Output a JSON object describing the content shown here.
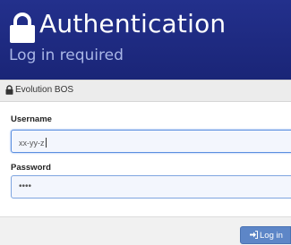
{
  "header": {
    "title": "Authentication",
    "subtitle": "Log in required"
  },
  "panel": {
    "title": "Evolution BOS"
  },
  "form": {
    "username_label": "Username",
    "username_value": "xx-yy-z",
    "password_label": "Password",
    "password_value": "••••"
  },
  "actions": {
    "login_label": "Log in"
  },
  "icons": {
    "header": "lock-icon",
    "panel": "lock-icon",
    "login": "sign-in-icon"
  },
  "colors": {
    "header_bg": "#1f2b85",
    "subtitle": "#a9b6e6",
    "button": "#5d86c7"
  }
}
